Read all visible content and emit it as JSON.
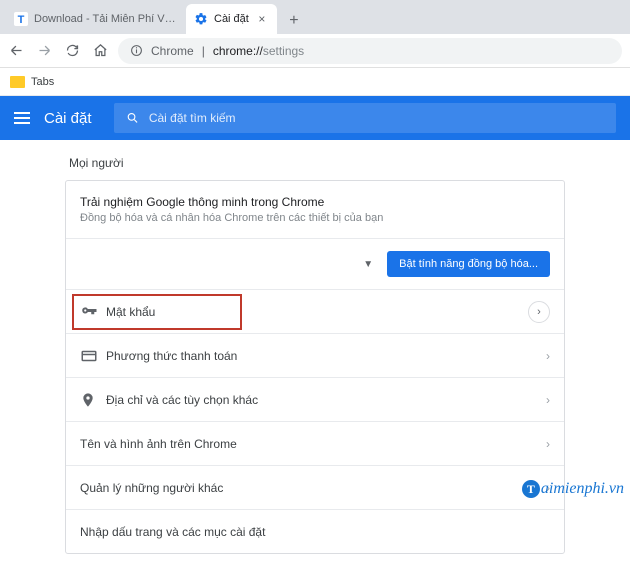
{
  "browser": {
    "tabs": [
      {
        "title": "Download - Tải Miễn Phí VN - Pl",
        "favicon": "T-blue",
        "active": false
      },
      {
        "title": "Cài đặt",
        "favicon": "gear-blue",
        "active": true
      }
    ],
    "omnibox": {
      "secure_label": "Chrome",
      "host_divider": " | ",
      "url_host": "chrome://",
      "url_path": "settings"
    },
    "bookmarks": [
      {
        "label": "Tabs"
      }
    ]
  },
  "app": {
    "title": "Cài đặt",
    "search_placeholder": "Cài đặt tìm kiếm"
  },
  "section": {
    "title": "Mọi người",
    "intro": {
      "headline": "Trải nghiệm Google thông minh trong Chrome",
      "desc": "Đồng bộ hóa và cá nhân hóa Chrome trên các thiết bị của bạn"
    },
    "sync_button": "Bật tính năng đồng bộ hóa...",
    "rows": [
      {
        "id": "passwords",
        "icon": "key",
        "label": "Mật khẩu",
        "nav": "circle"
      },
      {
        "id": "payment",
        "icon": "card",
        "label": "Phương thức thanh toán",
        "nav": "chevron"
      },
      {
        "id": "addresses",
        "icon": "pin",
        "label": "Địa chỉ và các tùy chọn khác",
        "nav": "chevron"
      },
      {
        "id": "name-image",
        "icon": "",
        "label": "Tên và hình ảnh trên Chrome",
        "nav": "chevron"
      },
      {
        "id": "manage-people",
        "icon": "",
        "label": "Quản lý những người khác",
        "nav": "chevron"
      },
      {
        "id": "import",
        "icon": "",
        "label": "Nhập dấu trang và các mục cài đặt",
        "nav": "none"
      }
    ]
  },
  "watermark": {
    "brand": "aimienphi",
    "suffix": ".vn"
  }
}
